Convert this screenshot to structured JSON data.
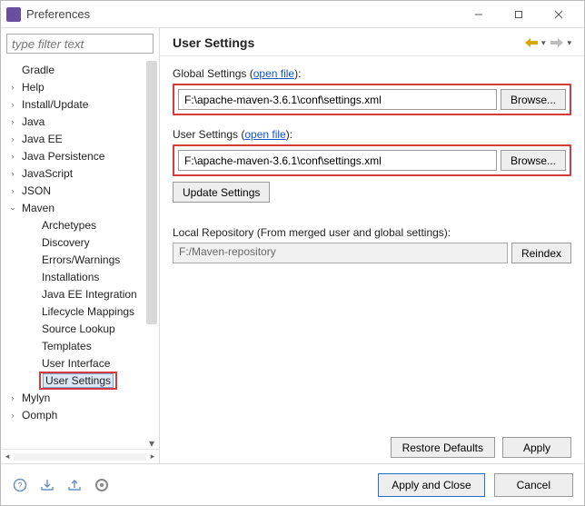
{
  "window": {
    "title": "Preferences"
  },
  "sidebar": {
    "filter_placeholder": "type filter text",
    "items": [
      {
        "label": "Gradle",
        "level": 1,
        "expand": "none"
      },
      {
        "label": "Help",
        "level": 1,
        "expand": "closed"
      },
      {
        "label": "Install/Update",
        "level": 1,
        "expand": "closed"
      },
      {
        "label": "Java",
        "level": 1,
        "expand": "closed"
      },
      {
        "label": "Java EE",
        "level": 1,
        "expand": "closed"
      },
      {
        "label": "Java Persistence",
        "level": 1,
        "expand": "closed"
      },
      {
        "label": "JavaScript",
        "level": 1,
        "expand": "closed"
      },
      {
        "label": "JSON",
        "level": 1,
        "expand": "closed"
      },
      {
        "label": "Maven",
        "level": 1,
        "expand": "open"
      },
      {
        "label": "Archetypes",
        "level": 2,
        "expand": "none"
      },
      {
        "label": "Discovery",
        "level": 2,
        "expand": "none"
      },
      {
        "label": "Errors/Warnings",
        "level": 2,
        "expand": "none"
      },
      {
        "label": "Installations",
        "level": 2,
        "expand": "none"
      },
      {
        "label": "Java EE Integration",
        "level": 2,
        "expand": "none"
      },
      {
        "label": "Lifecycle Mappings",
        "level": 2,
        "expand": "none"
      },
      {
        "label": "Source Lookup",
        "level": 2,
        "expand": "none"
      },
      {
        "label": "Templates",
        "level": 2,
        "expand": "none"
      },
      {
        "label": "User Interface",
        "level": 2,
        "expand": "none"
      },
      {
        "label": "User Settings",
        "level": 2,
        "expand": "none",
        "selected": true,
        "highlight": true
      },
      {
        "label": "Mylyn",
        "level": 1,
        "expand": "closed"
      },
      {
        "label": "Oomph",
        "level": 1,
        "expand": "closed"
      }
    ]
  },
  "main": {
    "heading": "User Settings",
    "global": {
      "label_prefix": "Global Settings (",
      "link": "open file",
      "label_suffix": "):",
      "value": "F:\\apache-maven-3.6.1\\conf\\settings.xml",
      "browse": "Browse..."
    },
    "user": {
      "label_prefix": "User Settings (",
      "link": "open file",
      "label_suffix": "):",
      "value": "F:\\apache-maven-3.6.1\\conf\\settings.xml",
      "browse": "Browse..."
    },
    "update_label": "Update Settings",
    "local_repo": {
      "label": "Local Repository (From merged user and global settings):",
      "value": "F:/Maven-repository",
      "reindex": "Reindex"
    },
    "restore": "Restore Defaults",
    "apply": "Apply"
  },
  "footer": {
    "apply_close": "Apply and Close",
    "cancel": "Cancel"
  }
}
